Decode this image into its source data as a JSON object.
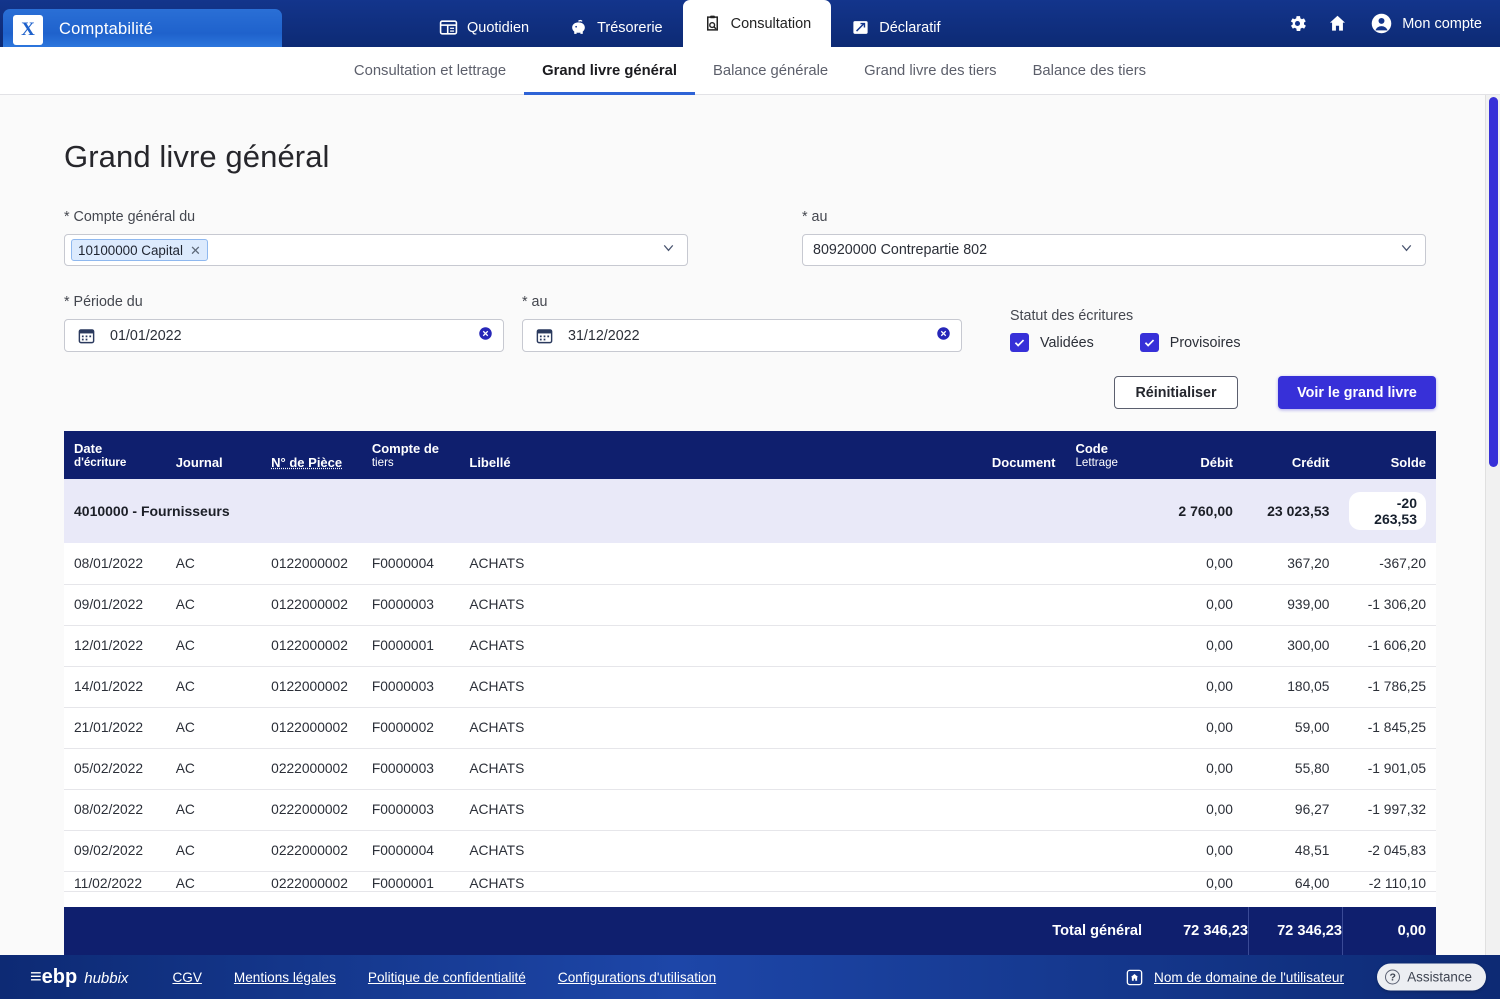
{
  "topbar": {
    "module_logo_glyph": "X",
    "module_title": "Comptabilité",
    "nav": [
      {
        "label": "Quotidien",
        "icon": "ledger-icon",
        "active": false
      },
      {
        "label": "Trésorerie",
        "icon": "piggy-bank-icon",
        "active": false
      },
      {
        "label": "Consultation",
        "icon": "clipboard-search-icon",
        "active": true
      },
      {
        "label": "Déclaratif",
        "icon": "declaration-icon",
        "active": false
      }
    ],
    "settings_icon": "gear-icon",
    "home_icon": "home-icon",
    "account_icon": "user-avatar-icon",
    "account_label": "Mon compte"
  },
  "subnav": {
    "items": [
      {
        "label": "Consultation et lettrage",
        "active": false
      },
      {
        "label": "Grand livre général",
        "active": true
      },
      {
        "label": "Balance générale",
        "active": false
      },
      {
        "label": "Grand livre des tiers",
        "active": false
      },
      {
        "label": "Balance des tiers",
        "active": false
      }
    ]
  },
  "page": {
    "title": "Grand livre général"
  },
  "filters": {
    "account_from": {
      "label": "* Compte général du",
      "token": "10100000 Capital",
      "token_remove_icon": "close-icon",
      "caret_icon": "chevron-down-icon"
    },
    "account_to": {
      "label": "* au",
      "value": "80920000 Contrepartie 802",
      "caret_icon": "chevron-down-icon"
    },
    "period_from": {
      "label": "* Période du",
      "value": "01/01/2022",
      "calendar_icon": "calendar-icon",
      "clear_icon": "clear-circle-icon"
    },
    "period_to": {
      "label": "* au",
      "value": "31/12/2022",
      "calendar_icon": "calendar-icon",
      "clear_icon": "clear-circle-icon"
    },
    "status": {
      "label": "Statut des écritures",
      "options": [
        {
          "label": "Validées",
          "checked": true
        },
        {
          "label": "Provisoires",
          "checked": true
        }
      ]
    },
    "reset_button": "Réinitialiser",
    "submit_button": "Voir le grand livre"
  },
  "table": {
    "columns": [
      {
        "key": "date",
        "line1": "Date",
        "line2": "d'écriture",
        "align": "left"
      },
      {
        "key": "journal",
        "line1": "Journal",
        "line2": "",
        "align": "left"
      },
      {
        "key": "piece",
        "line1": "N° de Pièce",
        "line2": "",
        "align": "left"
      },
      {
        "key": "tiers",
        "line1": "Compte de",
        "line2": "tiers",
        "align": "left"
      },
      {
        "key": "libelle",
        "line1": "Libellé",
        "line2": "",
        "align": "left"
      },
      {
        "key": "document",
        "line1": "Document",
        "line2": "",
        "align": "right"
      },
      {
        "key": "code",
        "line1": "Code",
        "line2": "Lettrage",
        "align": "left"
      },
      {
        "key": "debit",
        "line1": "Débit",
        "line2": "",
        "align": "right"
      },
      {
        "key": "credit",
        "line1": "Crédit",
        "line2": "",
        "align": "right"
      },
      {
        "key": "solde",
        "line1": "Solde",
        "line2": "",
        "align": "right"
      }
    ],
    "account_group": {
      "label": "4010000 - Fournisseurs",
      "debit": "2 760,00",
      "credit": "23 023,53",
      "solde": "-20 263,53"
    },
    "rows": [
      {
        "date": "08/01/2022",
        "journal": "AC",
        "piece": "0122000002",
        "tiers": "F0000004",
        "libelle": "ACHATS",
        "document": "",
        "code": "",
        "debit": "0,00",
        "credit": "367,20",
        "solde": "-367,20"
      },
      {
        "date": "09/01/2022",
        "journal": "AC",
        "piece": "0122000002",
        "tiers": "F0000003",
        "libelle": "ACHATS",
        "document": "",
        "code": "",
        "debit": "0,00",
        "credit": "939,00",
        "solde": "-1 306,20"
      },
      {
        "date": "12/01/2022",
        "journal": "AC",
        "piece": "0122000002",
        "tiers": "F0000001",
        "libelle": "ACHATS",
        "document": "",
        "code": "",
        "debit": "0,00",
        "credit": "300,00",
        "solde": "-1 606,20"
      },
      {
        "date": "14/01/2022",
        "journal": "AC",
        "piece": "0122000002",
        "tiers": "F0000003",
        "libelle": "ACHATS",
        "document": "",
        "code": "",
        "debit": "0,00",
        "credit": "180,05",
        "solde": "-1 786,25"
      },
      {
        "date": "21/01/2022",
        "journal": "AC",
        "piece": "0122000002",
        "tiers": "F0000002",
        "libelle": "ACHATS",
        "document": "",
        "code": "",
        "debit": "0,00",
        "credit": "59,00",
        "solde": "-1 845,25"
      },
      {
        "date": "05/02/2022",
        "journal": "AC",
        "piece": "0222000002",
        "tiers": "F0000003",
        "libelle": "ACHATS",
        "document": "",
        "code": "",
        "debit": "0,00",
        "credit": "55,80",
        "solde": "-1 901,05"
      },
      {
        "date": "08/02/2022",
        "journal": "AC",
        "piece": "0222000002",
        "tiers": "F0000003",
        "libelle": "ACHATS",
        "document": "",
        "code": "",
        "debit": "0,00",
        "credit": "96,27",
        "solde": "-1 997,32"
      },
      {
        "date": "09/02/2022",
        "journal": "AC",
        "piece": "0222000002",
        "tiers": "F0000004",
        "libelle": "ACHATS",
        "document": "",
        "code": "",
        "debit": "0,00",
        "credit": "48,51",
        "solde": "-2 045,83"
      },
      {
        "date": "11/02/2022",
        "journal": "AC",
        "piece": "0222000002",
        "tiers": "F0000001",
        "libelle": "ACHATS",
        "document": "",
        "code": "",
        "debit": "0,00",
        "credit": "64,00",
        "solde": "-2 110,10"
      }
    ],
    "total": {
      "label": "Total général",
      "debit": "72 346,23",
      "credit": "72 346,23",
      "solde": "0,00"
    }
  },
  "footer": {
    "brand_main": "≡ebp",
    "brand_sub": "hubbix",
    "links": [
      "CGV",
      "Mentions légales",
      "Politique de confidentialité",
      "Configurations d'utilisation"
    ],
    "domain_icon": "home-badge-icon",
    "domain_label": "Nom de domaine de l'utilisateur",
    "assistance_label": "Assistance",
    "assistance_icon": "question-mark-icon"
  },
  "colors": {
    "header_blue": "#0d2a74",
    "module_tab_blue": "#2a6fd6",
    "accent_indigo": "#3730d8",
    "table_header": "#0f1f6e",
    "group_row": "#e9e9f8",
    "subnav_active": "#2e63d6"
  }
}
